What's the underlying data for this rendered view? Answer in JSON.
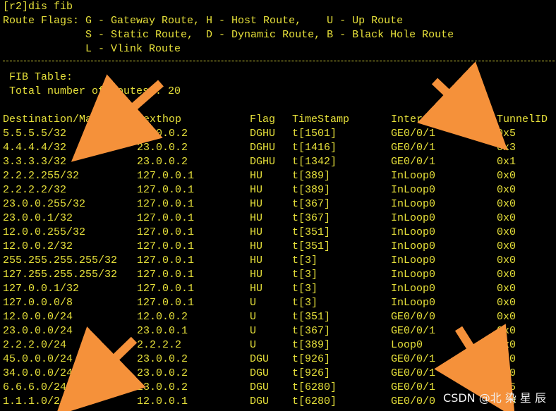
{
  "command": "[r2]dis fib",
  "flags": {
    "line1": "Route Flags: G - Gateway Route, H - Host Route,    U - Up Route",
    "line2": "             S - Static Route,  D - Dynamic Route, B - Black Hole Route",
    "line3": "             L - Vlink Route"
  },
  "fib": {
    "title": " FIB Table:",
    "total": " Total number of Routes : 20"
  },
  "headers": {
    "destination": "Destination/Mask",
    "nexthop": "Nexthop",
    "flag": "Flag",
    "timestamp": "TimeStamp",
    "interface": "Interface",
    "tunnel": "TunnelID"
  },
  "rows": [
    {
      "dest": "5.5.5.5/32",
      "nexthop": "23.0.0.2",
      "flag": "DGHU",
      "time": "t[1501]",
      "iface": "GE0/0/1",
      "tunnel": "0x5"
    },
    {
      "dest": "4.4.4.4/32",
      "nexthop": "23.0.0.2",
      "flag": "DGHU",
      "time": "t[1416]",
      "iface": "GE0/0/1",
      "tunnel": "0x3"
    },
    {
      "dest": "3.3.3.3/32",
      "nexthop": "23.0.0.2",
      "flag": "DGHU",
      "time": "t[1342]",
      "iface": "GE0/0/1",
      "tunnel": "0x1"
    },
    {
      "dest": "2.2.2.255/32",
      "nexthop": "127.0.0.1",
      "flag": "HU",
      "time": "t[389]",
      "iface": "InLoop0",
      "tunnel": "0x0"
    },
    {
      "dest": "2.2.2.2/32",
      "nexthop": "127.0.0.1",
      "flag": "HU",
      "time": "t[389]",
      "iface": "InLoop0",
      "tunnel": "0x0"
    },
    {
      "dest": "23.0.0.255/32",
      "nexthop": "127.0.0.1",
      "flag": "HU",
      "time": "t[367]",
      "iface": "InLoop0",
      "tunnel": "0x0"
    },
    {
      "dest": "23.0.0.1/32",
      "nexthop": "127.0.0.1",
      "flag": "HU",
      "time": "t[367]",
      "iface": "InLoop0",
      "tunnel": "0x0"
    },
    {
      "dest": "12.0.0.255/32",
      "nexthop": "127.0.0.1",
      "flag": "HU",
      "time": "t[351]",
      "iface": "InLoop0",
      "tunnel": "0x0"
    },
    {
      "dest": "12.0.0.2/32",
      "nexthop": "127.0.0.1",
      "flag": "HU",
      "time": "t[351]",
      "iface": "InLoop0",
      "tunnel": "0x0"
    },
    {
      "dest": "255.255.255.255/32",
      "nexthop": "127.0.0.1",
      "flag": "HU",
      "time": "t[3]",
      "iface": "InLoop0",
      "tunnel": "0x0"
    },
    {
      "dest": "127.255.255.255/32",
      "nexthop": "127.0.0.1",
      "flag": "HU",
      "time": "t[3]",
      "iface": "InLoop0",
      "tunnel": "0x0"
    },
    {
      "dest": "127.0.0.1/32",
      "nexthop": "127.0.0.1",
      "flag": "HU",
      "time": "t[3]",
      "iface": "InLoop0",
      "tunnel": "0x0"
    },
    {
      "dest": "127.0.0.0/8",
      "nexthop": "127.0.0.1",
      "flag": "U",
      "time": "t[3]",
      "iface": "InLoop0",
      "tunnel": "0x0"
    },
    {
      "dest": "12.0.0.0/24",
      "nexthop": "12.0.0.2",
      "flag": "U",
      "time": "t[351]",
      "iface": "GE0/0/0",
      "tunnel": "0x0"
    },
    {
      "dest": "23.0.0.0/24",
      "nexthop": "23.0.0.1",
      "flag": "U",
      "time": "t[367]",
      "iface": "GE0/0/1",
      "tunnel": "0x0"
    },
    {
      "dest": "2.2.2.0/24",
      "nexthop": "2.2.2.2",
      "flag": "U",
      "time": "t[389]",
      "iface": "Loop0",
      "tunnel": "0x0"
    },
    {
      "dest": "45.0.0.0/24",
      "nexthop": "23.0.0.2",
      "flag": "DGU",
      "time": "t[926]",
      "iface": "GE0/0/1",
      "tunnel": "0x0"
    },
    {
      "dest": "34.0.0.0/24",
      "nexthop": "23.0.0.2",
      "flag": "DGU",
      "time": "t[926]",
      "iface": "GE0/0/1",
      "tunnel": "0x0"
    },
    {
      "dest": "6.6.6.0/24",
      "nexthop": "23.0.0.2",
      "flag": "DGU",
      "time": "t[6280]",
      "iface": "GE0/0/1",
      "tunnel": "0x5"
    },
    {
      "dest": "1.1.1.0/24",
      "nexthop": "12.0.0.1",
      "flag": "DGU",
      "time": "t[6280]",
      "iface": "GE0/0/0",
      "tunnel": "0x0"
    }
  ],
  "watermark": "CSDN @北 染 星 辰",
  "colors": {
    "background": "#000000",
    "text": "#e6e03a",
    "arrow": "#f5913a"
  },
  "icons": [
    "arrow-icon"
  ]
}
